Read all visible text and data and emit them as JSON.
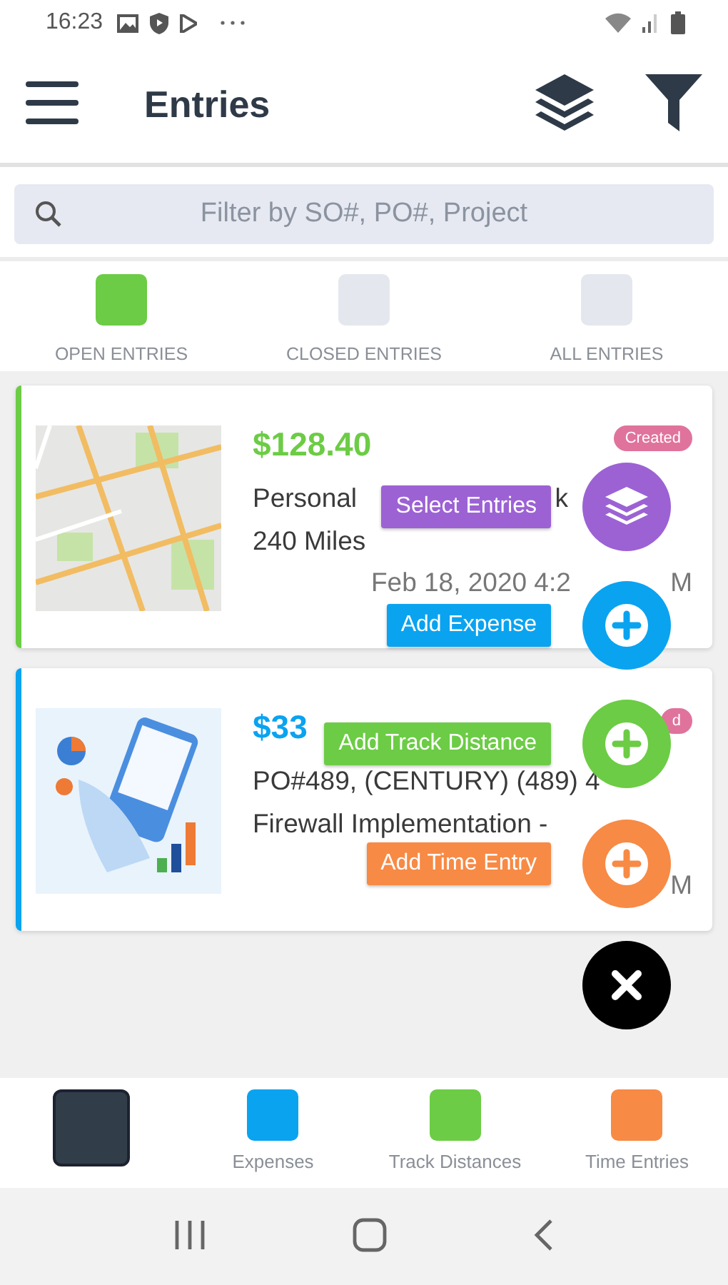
{
  "status_bar": {
    "time": "16:23"
  },
  "header": {
    "title": "Entries"
  },
  "search": {
    "placeholder": "Filter by SO#, PO#, Project"
  },
  "tabs": [
    {
      "label": "OPEN ENTRIES",
      "selected": true
    },
    {
      "label": "CLOSED ENTRIES",
      "selected": false
    },
    {
      "label": "ALL ENTRIES",
      "selected": false
    }
  ],
  "entries": [
    {
      "color": "#6ccc45",
      "image": {
        "kind": "map"
      },
      "amount": "$128.40",
      "badge": "Created",
      "lines": [
        [
          "Personal",
          "k"
        ],
        [
          "240 Miles"
        ]
      ],
      "date": [
        "Feb 18, 2020 4:2",
        "M"
      ]
    },
    {
      "color": "#0aa3f0",
      "image": {
        "kind": "illustration"
      },
      "amount": "$33",
      "badge": "d",
      "lines": [
        [
          "PO#489, (CENTURY) (489) 4"
        ],
        [
          "Firewall Implementation -"
        ]
      ],
      "date": [
        "M"
      ]
    }
  ],
  "fab_menu": {
    "actions": [
      {
        "label": "Select Entries",
        "color": "#9c62d4"
      },
      {
        "label": "Add Expense",
        "color": "#0aa3f0"
      },
      {
        "label": "Add Track Distance",
        "color": "#6ccc45"
      },
      {
        "label": "Add Time Entry",
        "color": "#f78a45"
      }
    ]
  },
  "bottom_nav": [
    {
      "color": "#323d4a",
      "selected": true
    },
    {
      "label": "Expenses",
      "color": "#0aa3f0",
      "selected": false
    },
    {
      "label": "Track Distances",
      "color": "#6ccc45",
      "selected": false
    },
    {
      "label": "Time Entries",
      "color": "#f78a45",
      "selected": false
    }
  ]
}
